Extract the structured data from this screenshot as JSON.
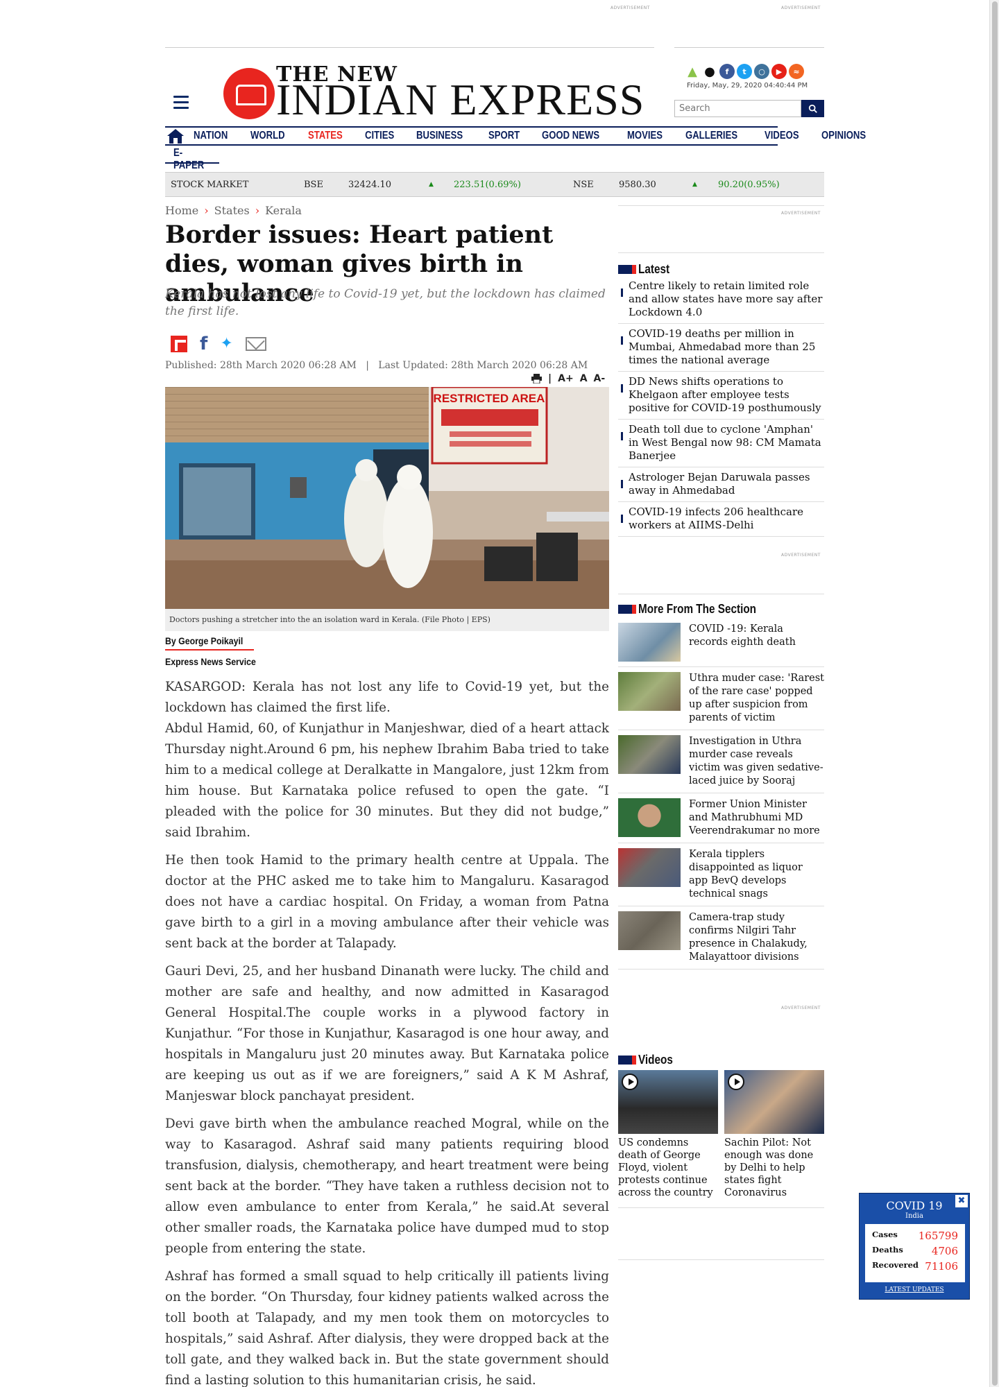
{
  "ads": {
    "label": "ADVERTISEMENT"
  },
  "header": {
    "logo_small": "THE NEW",
    "logo_big": "INDIAN EXPRESS",
    "social_icons": [
      "android-icon",
      "apple-icon",
      "facebook-icon",
      "twitter-icon",
      "instagram-icon",
      "youtube-icon",
      "rss-icon"
    ],
    "datetime": "Friday, May, 29, 2020   04:40:44 PM",
    "search_placeholder": "Search"
  },
  "nav": {
    "items": [
      "NATION",
      "WORLD",
      "STATES",
      "CITIES",
      "BUSINESS",
      "SPORT",
      "GOOD NEWS",
      "MOVIES",
      "GALLERIES",
      "VIDEOS",
      "OPINIONS"
    ],
    "active": "STATES",
    "epaper": "E-PAPER"
  },
  "stock": {
    "label": "STOCK MARKET",
    "bse_label": "BSE",
    "bse_value": "32424.10",
    "bse_change": "223.51(0.69%)",
    "nse_label": "NSE",
    "nse_value": "9580.30",
    "nse_change": "90.20(0.95%)"
  },
  "breadcrumb": [
    "Home",
    "States",
    "Kerala"
  ],
  "article": {
    "headline": "Border issues: Heart patient dies, woman gives birth in ambulance",
    "subhead": "Kerala has not lost any life to Covid-19 yet, but the lockdown has claimed the first life.",
    "published": "Published: 28th March 2020 06:28 AM   |   Last Updated: 28th March 2020 06:28 AM",
    "font_tools": [
      "A+",
      "A",
      "A-"
    ],
    "photo_sign_en": "RESTRICTED AREA",
    "caption": "Doctors pushing a stretcher into the an isolation ward in Kerala. (File Photo | EPS)",
    "byline": "By George Poikayil",
    "service": "Express News Service",
    "paragraphs": [
      "KASARGOD: Kerala has not lost any life to Covid-19 yet, but the lockdown has claimed the first life.",
      "Abdul Hamid, 60, of Kunjathur in Manjeshwar, died of a heart attack Thursday night.Around 6 pm, his nephew Ibrahim Baba tried to take him to a medical college at Deralkatte in Mangalore, just 12km from him house. But Karnataka police refused to open the gate. “I pleaded with the police for 30 minutes. But they did not budge,” said Ibrahim.",
      "He then took Hamid to the primary health centre at Uppala. The doctor at the PHC asked me to take him to Mangaluru. Kasaragod does not have a cardiac hospital. On Friday, a woman from Patna gave birth to a girl in a moving ambulance after their vehicle was sent back at the border at Talapady.",
      "Gauri Devi, 25, and her husband Dinanath were lucky. The child and mother are safe and healthy, and now admitted in Kasaragod General Hospital.The couple works in a plywood factory in Kunjathur. “For those in Kunjathur, Kasaragod is one hour away, and hospitals in Mangaluru just 20 minutes away. But Karnataka police are keeping us out as if we are foreigners,” said A K M Ashraf, Manjeswar block panchayat president.",
      "Devi gave birth when the ambulance reached Mogral, while on the way to Kasaragod. Ashraf said many patients requiring blood transfusion, dialysis, chemotherapy, and heart treatment were being sent back at the border. “They have taken a ruthless decision not to allow even ambulance to enter from Kerala,” he said.At several other smaller roads, the Karnataka police have dumped mud to stop people from entering the state.",
      "Ashraf has formed a small squad to help critically ill patients living on the border. “On Thursday, four kidney patients walked across the toll booth at Talapady, and my men took them on motorcycles to hospitals,” said Ashraf. After dialysis, they were dropped back at the toll gate, and they walked back in. But the state government should find a lasting solution to this humanitarian crisis, he said."
    ]
  },
  "sidebar": {
    "latest_title": "Latest",
    "latest": [
      "Centre likely to retain limited role and allow states have more say after Lockdown 4.0",
      "COVID-19 deaths per million in Mumbai, Ahmedabad more than 25 times the national average",
      "DD News shifts operations to Khelgaon after employee tests positive for COVID-19 posthumously",
      "Death toll due to cyclone 'Amphan' in West Bengal now 98: CM Mamata Banerjee",
      "Astrologer Bejan Daruwala passes away in Ahmedabad",
      "COVID-19 infects 206 healthcare workers at AIIMS-Delhi"
    ],
    "more_title": "More From The Section",
    "more": [
      "COVID -19: Kerala records eighth death",
      "Uthra muder case: 'Rarest of the rare case' popped up after suspicion from parents of victim",
      "Investigation in Uthra murder case reveals victim was given sedative-laced juice by Sooraj",
      "Former Union Minister and Mathrubhumi MD Veerendrakumar no more",
      "Kerala tipplers disappointed as liquor app BevQ develops technical snags",
      "Camera-trap study confirms Nilgiri Tahr presence in Chalakudy, Malayattoor divisions"
    ],
    "videos_title": "Videos",
    "videos": [
      "US condemns death of George Floyd, violent protests continue across the country",
      "Sachin Pilot: Not enough was done by Delhi to help states fight Coronavirus"
    ]
  },
  "covid_widget": {
    "title": "COVID 19",
    "region": "India",
    "rows": [
      {
        "label": "Cases",
        "value": "165799"
      },
      {
        "label": "Deaths",
        "value": "4706"
      },
      {
        "label": "Recovered",
        "value": "71106"
      }
    ],
    "link": "LATEST UPDATES"
  }
}
